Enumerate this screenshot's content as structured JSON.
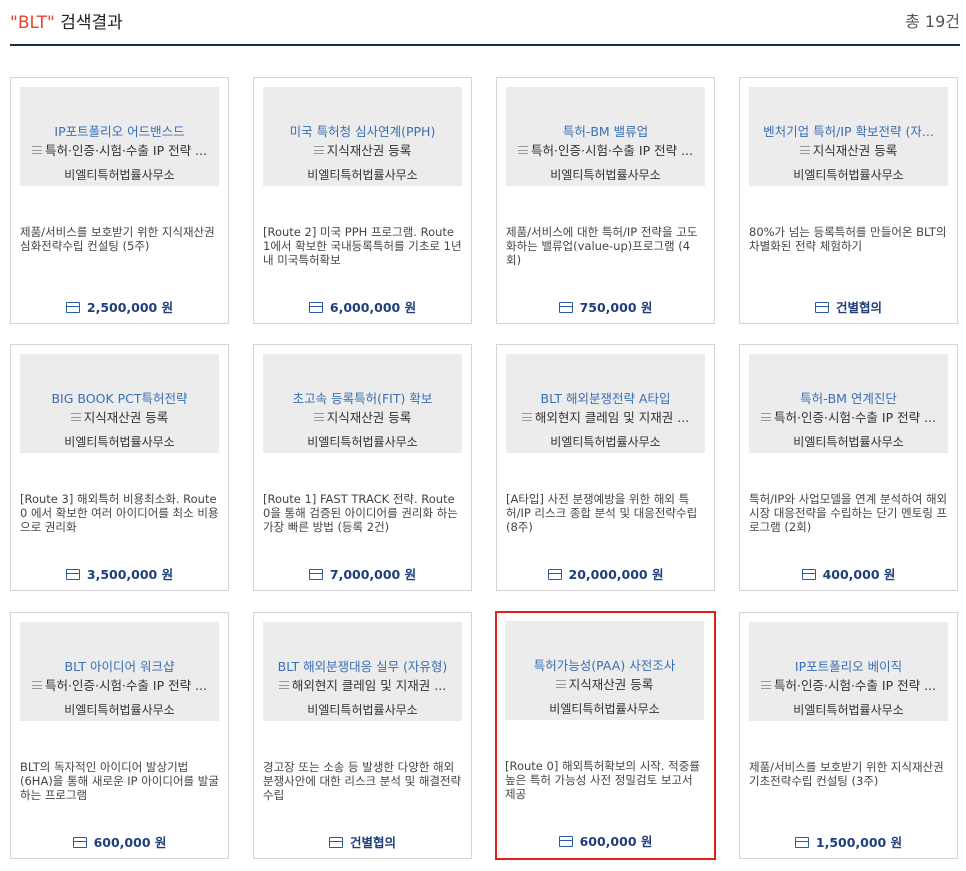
{
  "header": {
    "query": "\"BLT\"",
    "suffix": " 검색결과",
    "total": "총 19건"
  },
  "icons": {
    "category": "menu-icon",
    "price": "card-icon"
  },
  "colors": {
    "query": "#e8452c",
    "title": "#3a6fb4",
    "price": "#1f3f7a",
    "selected_border": "#e01f1f",
    "rule": "#1b2a4e"
  },
  "products": [
    {
      "title": "IP포트폴리오 어드밴스드",
      "category": "특허·인증·시험·수출 IP 전략 ...",
      "firm": "비엘티특허법률사무소",
      "desc": "제품/서비스를 보호받기 위한 지식재산권 심화전략수립 컨설팅 (5주)",
      "price": "2,500,000 원",
      "selected": false
    },
    {
      "title": "미국 특허청 심사연계(PPH)",
      "category": "지식재산권 등록",
      "firm": "비엘티특허법률사무소",
      "desc": "[Route 2] 미국 PPH 프로그램. Route 1에서 확보한 국내등록특허를 기초로 1년내 미국특허확보",
      "price": "6,000,000 원",
      "selected": false
    },
    {
      "title": "특허-BM 밸류업",
      "category": "특허·인증·시험·수출 IP 전략 ...",
      "firm": "비엘티특허법률사무소",
      "desc": "제품/서비스에 대한 특허/IP 전략을 고도화하는 밸류업(value-up)프로그램 (4회)",
      "price": "750,000 원",
      "selected": false
    },
    {
      "title": "벤처기업 특허/IP 확보전략 (자...",
      "category": "지식재산권 등록",
      "firm": "비엘티특허법률사무소",
      "desc": "80%가 넘는 등록특허를 만들어온 BLT의 차별화된 전략 체험하기",
      "price": "건별협의",
      "selected": false
    },
    {
      "title": "BIG BOOK PCT특허전략",
      "category": "지식재산권 등록",
      "firm": "비엘티특허법률사무소",
      "desc": "[Route 3] 해외특허 비용최소화. Route 0 에서 확보한 여러 아이디어를 최소 비용으로 권리화",
      "price": "3,500,000 원",
      "selected": false
    },
    {
      "title": "초고속 등록특허(FIT) 확보",
      "category": "지식재산권 등록",
      "firm": "비엘티특허법률사무소",
      "desc": "[Route 1] FAST TRACK 전략. Route 0을 통해 검증된 아이디어를 권리화 하는 가장 빠른 방법 (등록 2건)",
      "price": "7,000,000 원",
      "selected": false
    },
    {
      "title": "BLT 해외분쟁전략 A타입",
      "category": "해외현지 클레임 및 지재권 ...",
      "firm": "비엘티특허법률사무소",
      "desc": "[A타입] 사전 분쟁예방을 위한 해외 특허/IP 리스크 종합 분석 및 대응전략수립 (8주)",
      "price": "20,000,000 원",
      "selected": false
    },
    {
      "title": "특허-BM 연계진단",
      "category": "특허·인증·시험·수출 IP 전략 ...",
      "firm": "비엘티특허법률사무소",
      "desc": "특허/IP와 사업모델을 연계 분석하여 해외시장 대응전략을 수립하는 단기 멘토링 프로그램 (2회)",
      "price": "400,000 원",
      "selected": false
    },
    {
      "title": "BLT 아이디어 워크샵",
      "category": "특허·인증·시험·수출 IP 전략 ...",
      "firm": "비엘티특허법률사무소",
      "desc": "BLT의 독자적인 아이디어 발상기법(6HA)을 통해 새로운 IP 아이디어를 발굴하는 프로그램",
      "price": "600,000 원",
      "selected": false
    },
    {
      "title": "BLT 해외분쟁대응 실무 (자유형)",
      "category": "해외현지 클레임 및 지재권 ...",
      "firm": "비엘티특허법률사무소",
      "desc": "경고장 또는 소송 등 발생한 다양한 해외분쟁사안에 대한 리스크 분석 및 해결전략 수립",
      "price": "건별협의",
      "selected": false
    },
    {
      "title": "특허가능성(PAA) 사전조사",
      "category": "지식재산권 등록",
      "firm": "비엘티특허법률사무소",
      "desc": "[Route 0] 해외특허확보의 시작. 적중률 높은 특허 가능성 사전 정밀검토 보고서 제공",
      "price": "600,000 원",
      "selected": true
    },
    {
      "title": "IP포트폴리오 베이직",
      "category": "특허·인증·시험·수출 IP 전략 ...",
      "firm": "비엘티특허법률사무소",
      "desc": "제품/서비스를 보호받기 위한 지식재산권 기초전략수립 컨설팅 (3주)",
      "price": "1,500,000 원",
      "selected": false
    }
  ]
}
